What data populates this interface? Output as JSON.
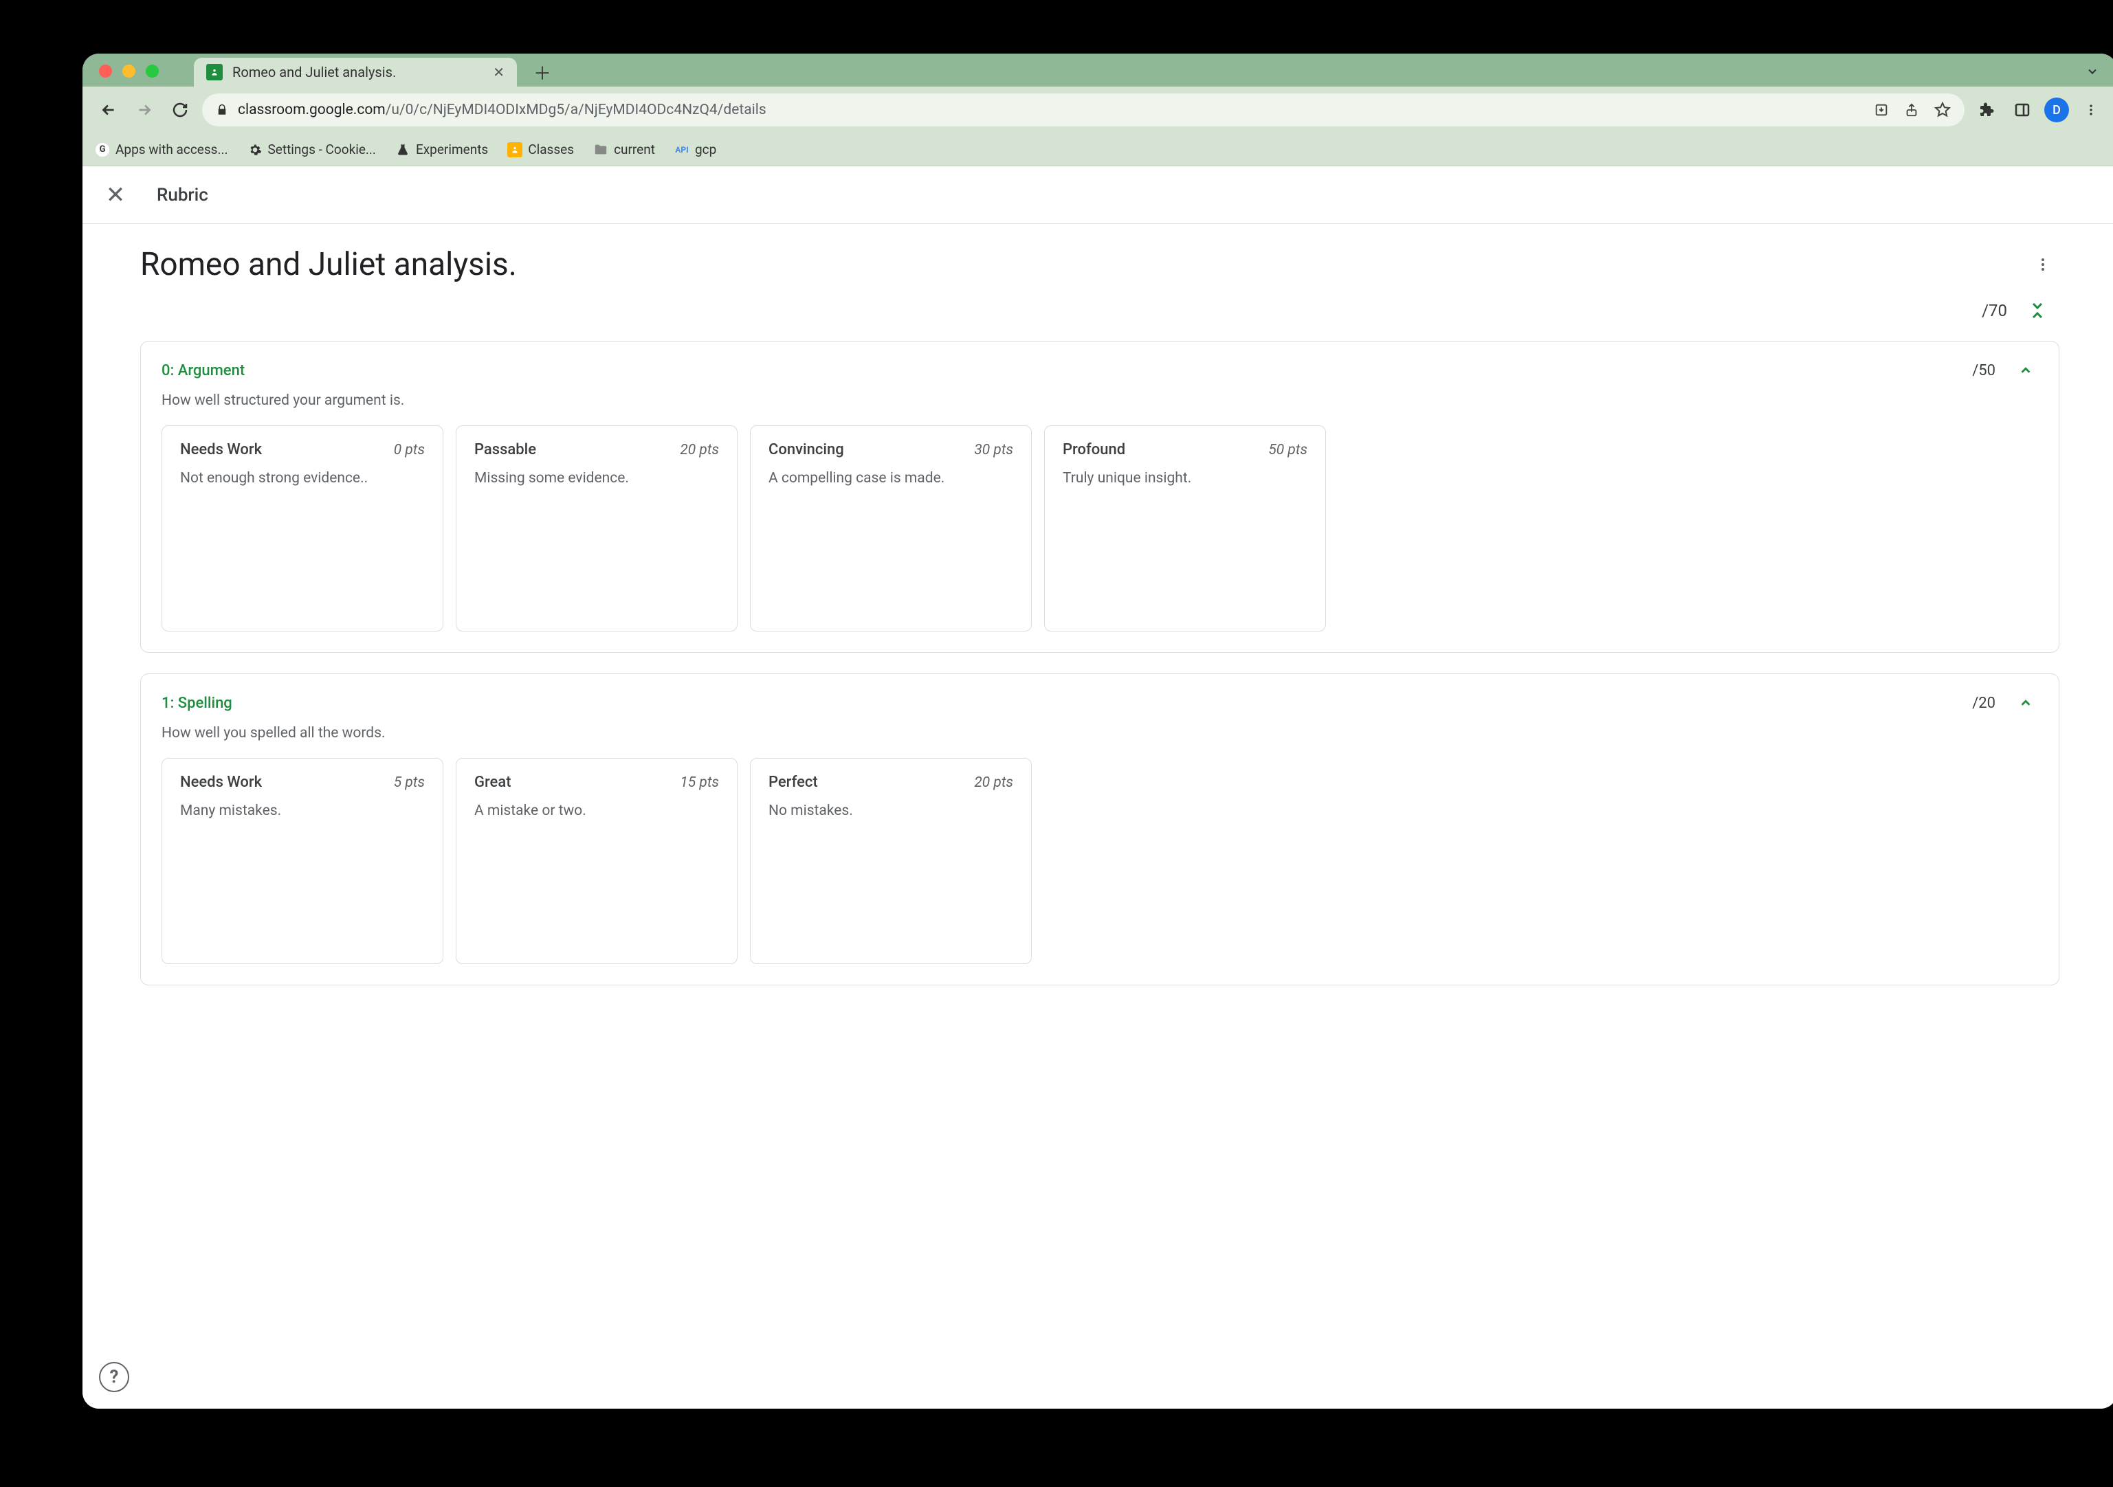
{
  "browser": {
    "tab_title": "Romeo and Juliet analysis.",
    "url_domain": "classroom.google.com",
    "url_path": "/u/0/c/NjEyMDI4ODIxMDg5/a/NjEyMDI4ODc4NzQ4/details",
    "avatar_letter": "D",
    "bookmarks": [
      {
        "label": "Apps with access..."
      },
      {
        "label": "Settings - Cookie..."
      },
      {
        "label": "Experiments"
      },
      {
        "label": "Classes"
      },
      {
        "label": "current"
      },
      {
        "label": "gcp",
        "prefix": "API"
      }
    ]
  },
  "page": {
    "header_label": "Rubric",
    "title": "Romeo and Juliet analysis.",
    "total_points": "/70",
    "criteria": [
      {
        "name": "0: Argument",
        "points": "/50",
        "description": "How well structured your argument is.",
        "levels": [
          {
            "name": "Needs Work",
            "pts": "0 pts",
            "desc": "Not enough strong evidence.."
          },
          {
            "name": "Passable",
            "pts": "20 pts",
            "desc": "Missing some evidence."
          },
          {
            "name": "Convincing",
            "pts": "30 pts",
            "desc": "A compelling case is made."
          },
          {
            "name": "Profound",
            "pts": "50 pts",
            "desc": "Truly unique insight."
          }
        ]
      },
      {
        "name": "1: Spelling",
        "points": "/20",
        "description": "How well you spelled all the words.",
        "levels": [
          {
            "name": "Needs Work",
            "pts": "5 pts",
            "desc": "Many mistakes."
          },
          {
            "name": "Great",
            "pts": "15 pts",
            "desc": "A mistake or two."
          },
          {
            "name": "Perfect",
            "pts": "20 pts",
            "desc": "No mistakes."
          }
        ]
      }
    ]
  }
}
